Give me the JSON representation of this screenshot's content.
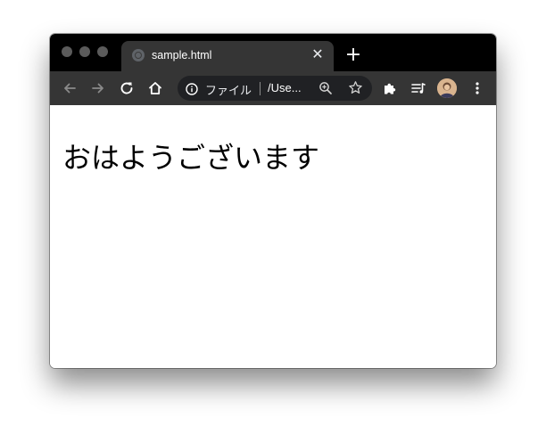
{
  "window": {
    "icons": [
      "close-dot",
      "minimize-dot",
      "maximize-dot"
    ]
  },
  "tab": {
    "title": "sample.html",
    "close_glyph": "✕",
    "favicon": "globe-icon"
  },
  "new_tab_glyph": "+",
  "toolbar": {
    "icons": [
      "back-arrow-icon",
      "forward-arrow-icon",
      "reload-icon",
      "home-icon",
      "extensions-icon",
      "media-control-icon",
      "avatar",
      "kebab-menu-icon"
    ]
  },
  "omnibox": {
    "scheme_label": "ファイル",
    "url_text": "/Use...",
    "icons": [
      "info-icon",
      "zoom-icon",
      "bookmark-star-icon"
    ]
  },
  "page": {
    "heading": "おはようございます"
  },
  "colors": {
    "titlebar": "#000000",
    "tab_active": "#353535",
    "toolbar": "#353535",
    "omnibox": "#202124",
    "page_background": "#ffffff"
  }
}
